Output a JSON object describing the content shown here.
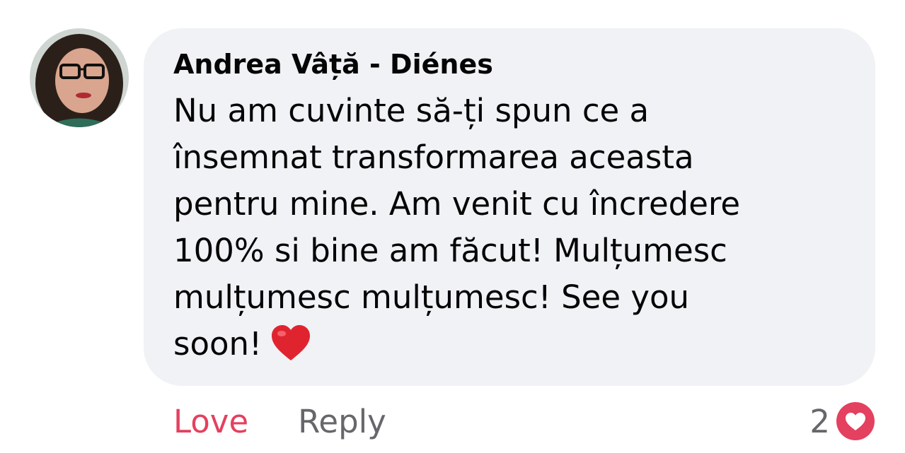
{
  "comment": {
    "author": "Andrea Vâță - Diénes",
    "body_lines": [
      "Nu am cuvinte să-ți spun ce a",
      "însemnat transformarea aceasta",
      "pentru mine. Am venit cu încredere",
      "100% si bine am făcut! Mulțumesc",
      "mulțumesc mulțumesc! See you",
      "soon!"
    ],
    "emoji": "heart-emoji"
  },
  "actions": {
    "love_label": "Love",
    "reply_label": "Reply"
  },
  "reactions": {
    "count": "2",
    "icon": "love-reaction-icon"
  },
  "colors": {
    "bubble_bg": "#f0f2f5",
    "love": "#e4405f",
    "secondary_text": "#65676b",
    "primary_text": "#050505"
  }
}
